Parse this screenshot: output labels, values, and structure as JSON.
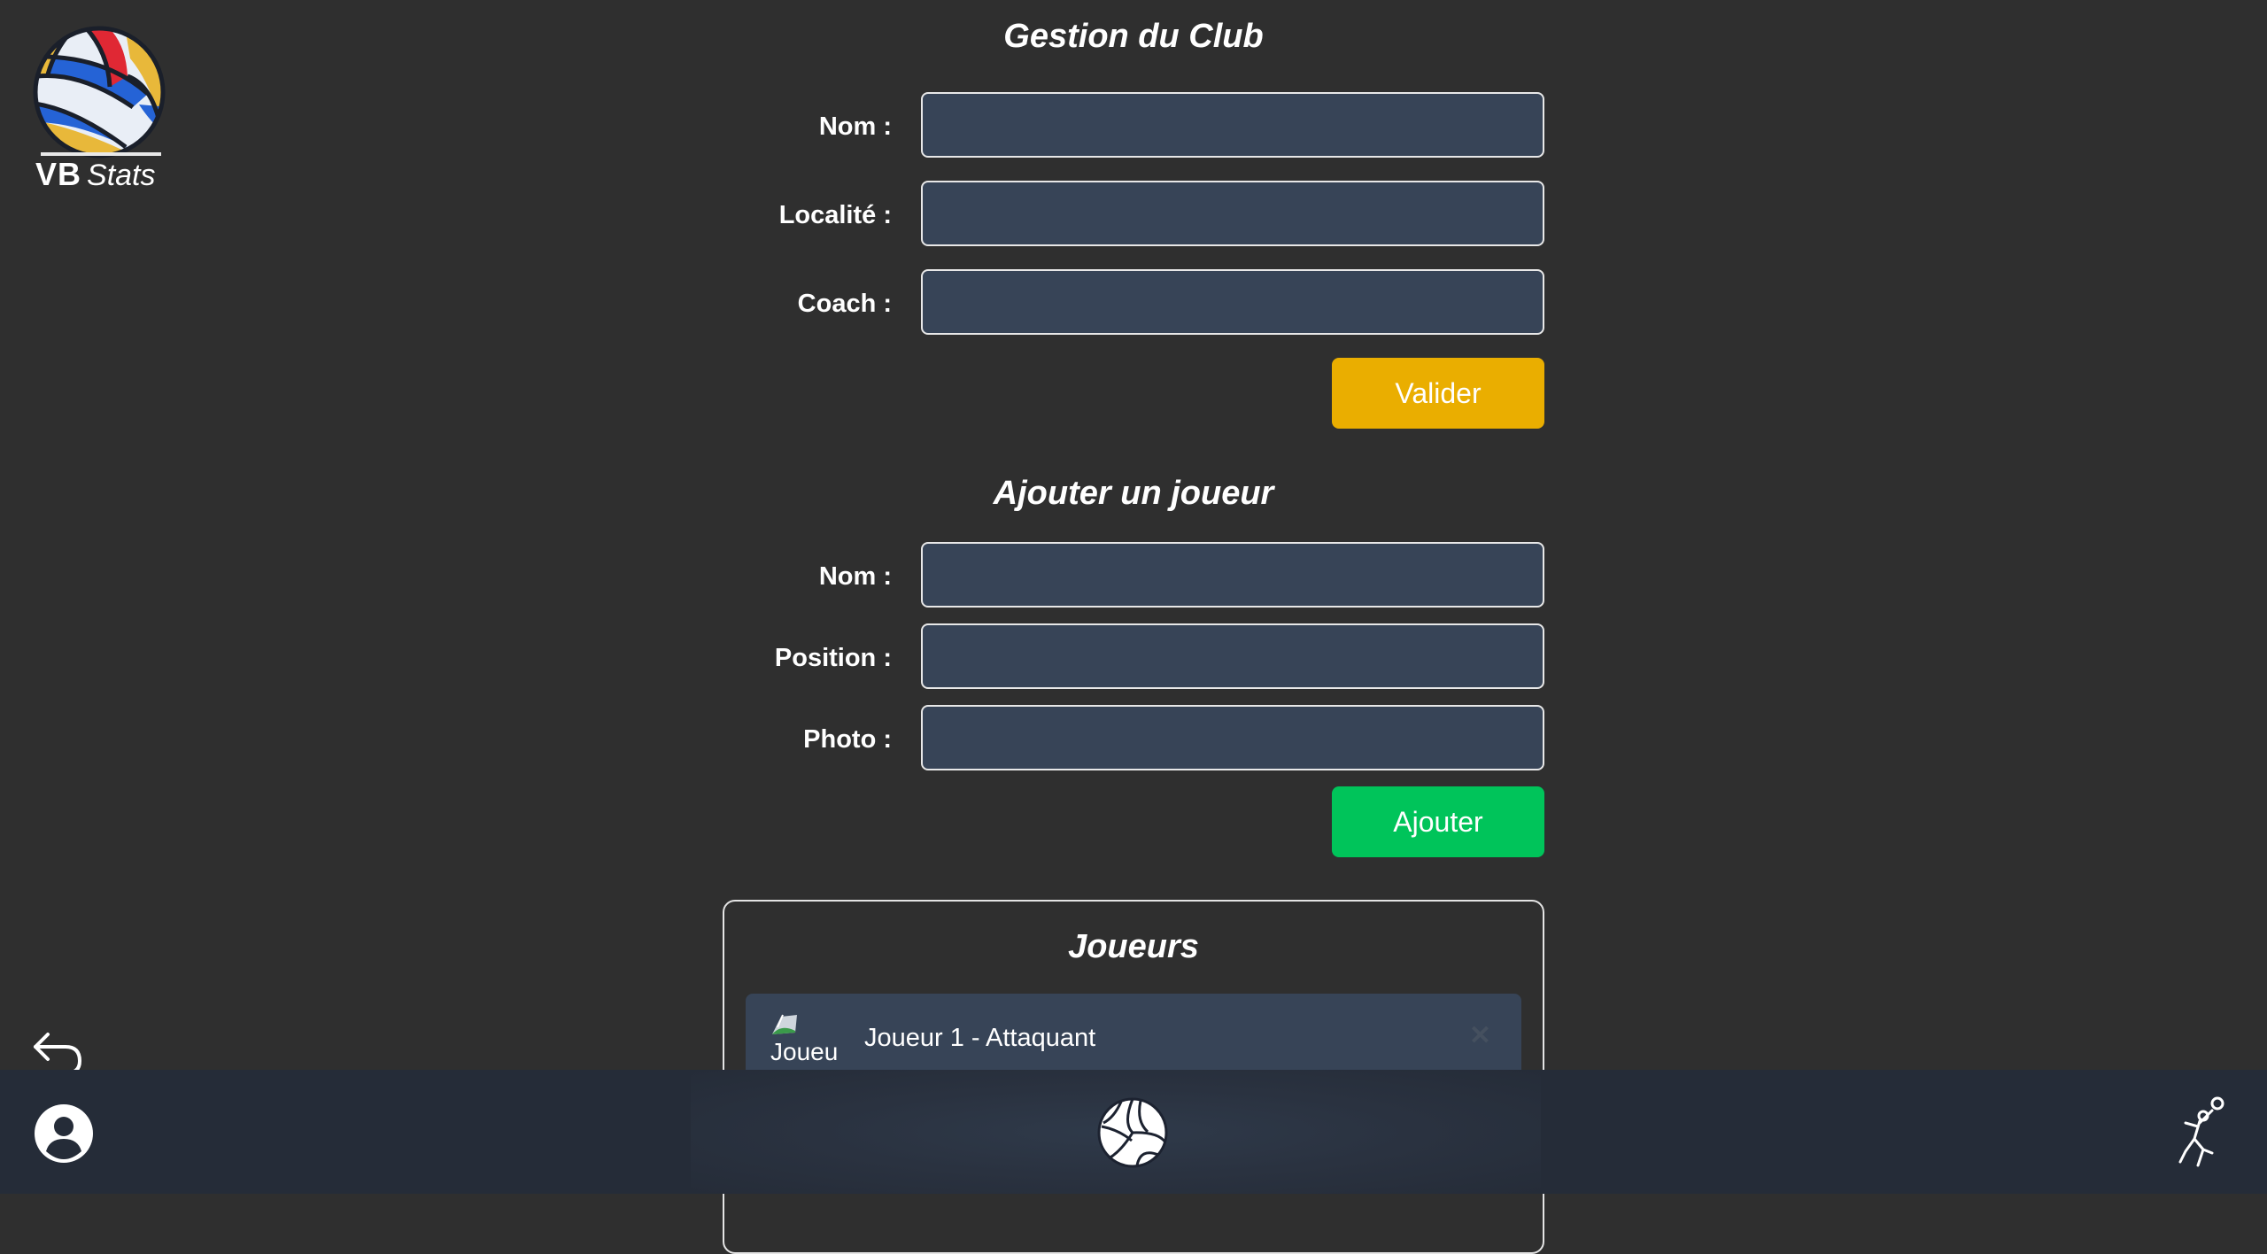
{
  "logo": {
    "brand_bold": "VB",
    "brand_italic": "Stats"
  },
  "club_section": {
    "title": "Gestion du Club",
    "fields": [
      {
        "label": "Nom :",
        "value": ""
      },
      {
        "label": "Localité :",
        "value": ""
      },
      {
        "label": "Coach :",
        "value": ""
      }
    ],
    "submit_label": "Valider"
  },
  "player_section": {
    "title": "Ajouter un joueur",
    "fields": [
      {
        "label": "Nom :",
        "value": ""
      },
      {
        "label": "Position :",
        "value": ""
      },
      {
        "label": "Photo :",
        "value": ""
      }
    ],
    "submit_label": "Ajouter"
  },
  "players_list": {
    "title": "Joueurs",
    "items": [
      {
        "photo_alt": "Joueu",
        "name": "Joueur 1 - Attaquant",
        "remove_icon": "close-icon"
      }
    ]
  },
  "nav": {
    "icons": [
      "back-arrow-icon",
      "user-icon",
      "volleyball-icon",
      "volleyball-player-icon"
    ]
  },
  "colors": {
    "background": "#2f2f2f",
    "input_bg": "#374457",
    "valider": "#eaae00",
    "ajouter": "#00c45a",
    "bottom_bar": "#252c38"
  }
}
